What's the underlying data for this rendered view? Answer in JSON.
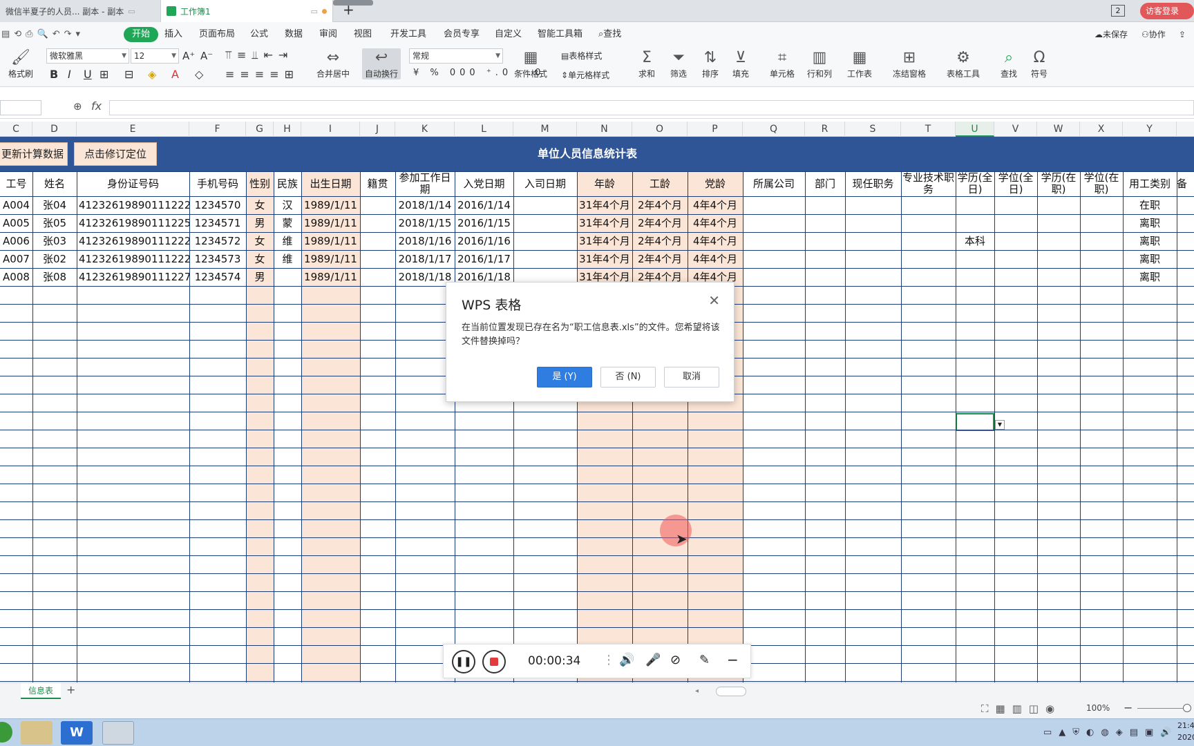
{
  "tabs": [
    {
      "label": "微信半夏子的人员... 副本 - 副本",
      "active": false
    },
    {
      "label": "工作簿1",
      "active": true
    }
  ],
  "topright": {
    "badge": "2",
    "login": "访客登录"
  },
  "menu": [
    "开始",
    "插入",
    "页面布局",
    "公式",
    "数据",
    "审阅",
    "视图",
    "开发工具",
    "会员专享",
    "自定义",
    "智能工具箱",
    "查找"
  ],
  "menu_right": {
    "unsaved": "未保存",
    "collab": "协作"
  },
  "ribbon": {
    "format_painter": "格式刷",
    "font_name": "微软雅黑",
    "font_size": "12",
    "merge_center": "合并居中",
    "auto_wrap": "自动换行",
    "number_format": "常规",
    "cond_format": "条件格式",
    "table_style": "表格样式",
    "cell_style": "单元格样式",
    "sum": "求和",
    "filter": "筛选",
    "sort": "排序",
    "fill": "填充",
    "cell": "单元格",
    "rowcol": "行和列",
    "worksheet": "工作表",
    "freeze": "冻结窗格",
    "table_tools": "表格工具",
    "find": "查找",
    "symbol": "符号"
  },
  "formula": {
    "fx": "fx",
    "value": ""
  },
  "col_headers": [
    "C",
    "D",
    "E",
    "F",
    "G",
    "H",
    "I",
    "J",
    "K",
    "L",
    "M",
    "N",
    "O",
    "P",
    "Q",
    "R",
    "S",
    "T",
    "U",
    "V",
    "W",
    "X",
    "Y"
  ],
  "sheet": {
    "title": "单位人员信息统计表",
    "btn_update": "更新计算数据",
    "btn_locate": "点击修订定位",
    "headers": [
      "工号",
      "姓名",
      "身份证号码",
      "手机号码",
      "性别",
      "民族",
      "出生日期",
      "籍贯",
      "参加工作日期",
      "入党日期",
      "入司日期",
      "年龄",
      "工龄",
      "党龄",
      "所属公司",
      "部门",
      "现任职务",
      "专业技术职务",
      "学历(全日)",
      "学位(全日)",
      "学历(在职)",
      "学位(在职)",
      "用工类别",
      "备"
    ],
    "rows": [
      [
        "A004",
        "张04",
        "41232619890111222",
        "1234570",
        "女",
        "汉",
        "1989/1/11",
        "",
        "2018/1/14",
        "2016/1/14",
        "",
        "31年4个月",
        "2年4个月",
        "4年4个月",
        "",
        "",
        "",
        "",
        "",
        "",
        "",
        "",
        "在职"
      ],
      [
        "A005",
        "张05",
        "41232619890111225",
        "1234571",
        "男",
        "蒙",
        "1989/1/11",
        "",
        "2018/1/15",
        "2016/1/15",
        "",
        "31年4个月",
        "2年4个月",
        "4年4个月",
        "",
        "",
        "",
        "",
        "",
        "",
        "",
        "",
        "离职"
      ],
      [
        "A006",
        "张03",
        "41232619890111222",
        "1234572",
        "女",
        "维",
        "1989/1/11",
        "",
        "2018/1/16",
        "2016/1/16",
        "",
        "31年4个月",
        "2年4个月",
        "4年4个月",
        "",
        "",
        "",
        "",
        "本科",
        "",
        "",
        "",
        "离职"
      ],
      [
        "A007",
        "张02",
        "41232619890111222",
        "1234573",
        "女",
        "维",
        "1989/1/11",
        "",
        "2018/1/17",
        "2016/1/17",
        "",
        "31年4个月",
        "2年4个月",
        "4年4个月",
        "",
        "",
        "",
        "",
        "",
        "",
        "",
        "",
        "离职"
      ],
      [
        "A008",
        "张08",
        "41232619890111227",
        "1234574",
        "男",
        "",
        "1989/1/11",
        "",
        "2018/1/18",
        "2016/1/18",
        "",
        "31年4个月",
        "2年4个月",
        "4年4个月",
        "",
        "",
        "",
        "",
        "",
        "",
        "",
        "",
        "离职"
      ]
    ]
  },
  "dialog": {
    "title": "WPS 表格",
    "message": "在当前位置发现已存在名为“职工信息表.xls”的文件。您希望将该文件替换掉吗？",
    "yes": "是 (Y)",
    "no": "否 (N)",
    "cancel": "取消"
  },
  "recorder": {
    "time": "00:00:34"
  },
  "sheet_tab": "信息表",
  "status": {
    "zoom": "100%"
  },
  "clock": {
    "time": "21:4",
    "date": "2020"
  },
  "colors": {
    "title_bg": "#2f5597",
    "pink": "#fbe5d6",
    "accent": "#1fa757",
    "primary_btn": "#2f7de1"
  }
}
